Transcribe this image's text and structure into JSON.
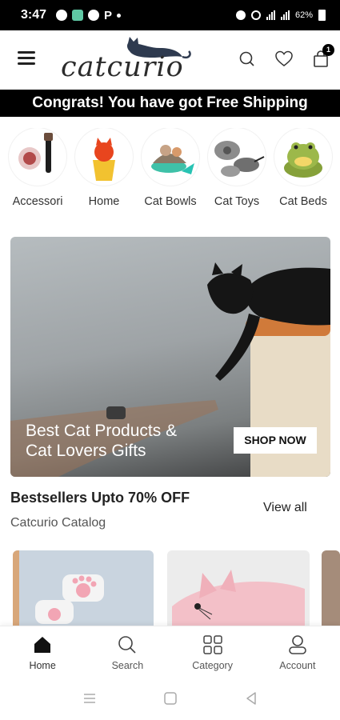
{
  "status_bar": {
    "time": "3:47",
    "letter": "P",
    "right_text": "62%"
  },
  "header": {
    "logo_text": "catcurio",
    "cart_count": "1"
  },
  "promo": {
    "text": "Congrats! You have got Free Shipping"
  },
  "categories": [
    {
      "label": "Accessori"
    },
    {
      "label": "Home"
    },
    {
      "label": "Cat Bowls"
    },
    {
      "label": "Cat Toys"
    },
    {
      "label": "Cat Beds"
    }
  ],
  "hero": {
    "title_line1": "Best Cat Products &",
    "title_line2": "Cat Lovers Gifts",
    "button_label": "SHOP NOW"
  },
  "bestsellers": {
    "title": "Bestsellers Upto 70% OFF",
    "subtitle": "Catcurio Catalog",
    "view_all": "View all"
  },
  "bottom_nav": [
    {
      "label": "Home",
      "icon": "home-icon",
      "active": true
    },
    {
      "label": "Search",
      "icon": "search-icon",
      "active": false
    },
    {
      "label": "Category",
      "icon": "category-grid-icon",
      "active": false
    },
    {
      "label": "Account",
      "icon": "account-icon",
      "active": false
    }
  ],
  "colors": {
    "accent": "#000000",
    "background": "#ffffff"
  }
}
